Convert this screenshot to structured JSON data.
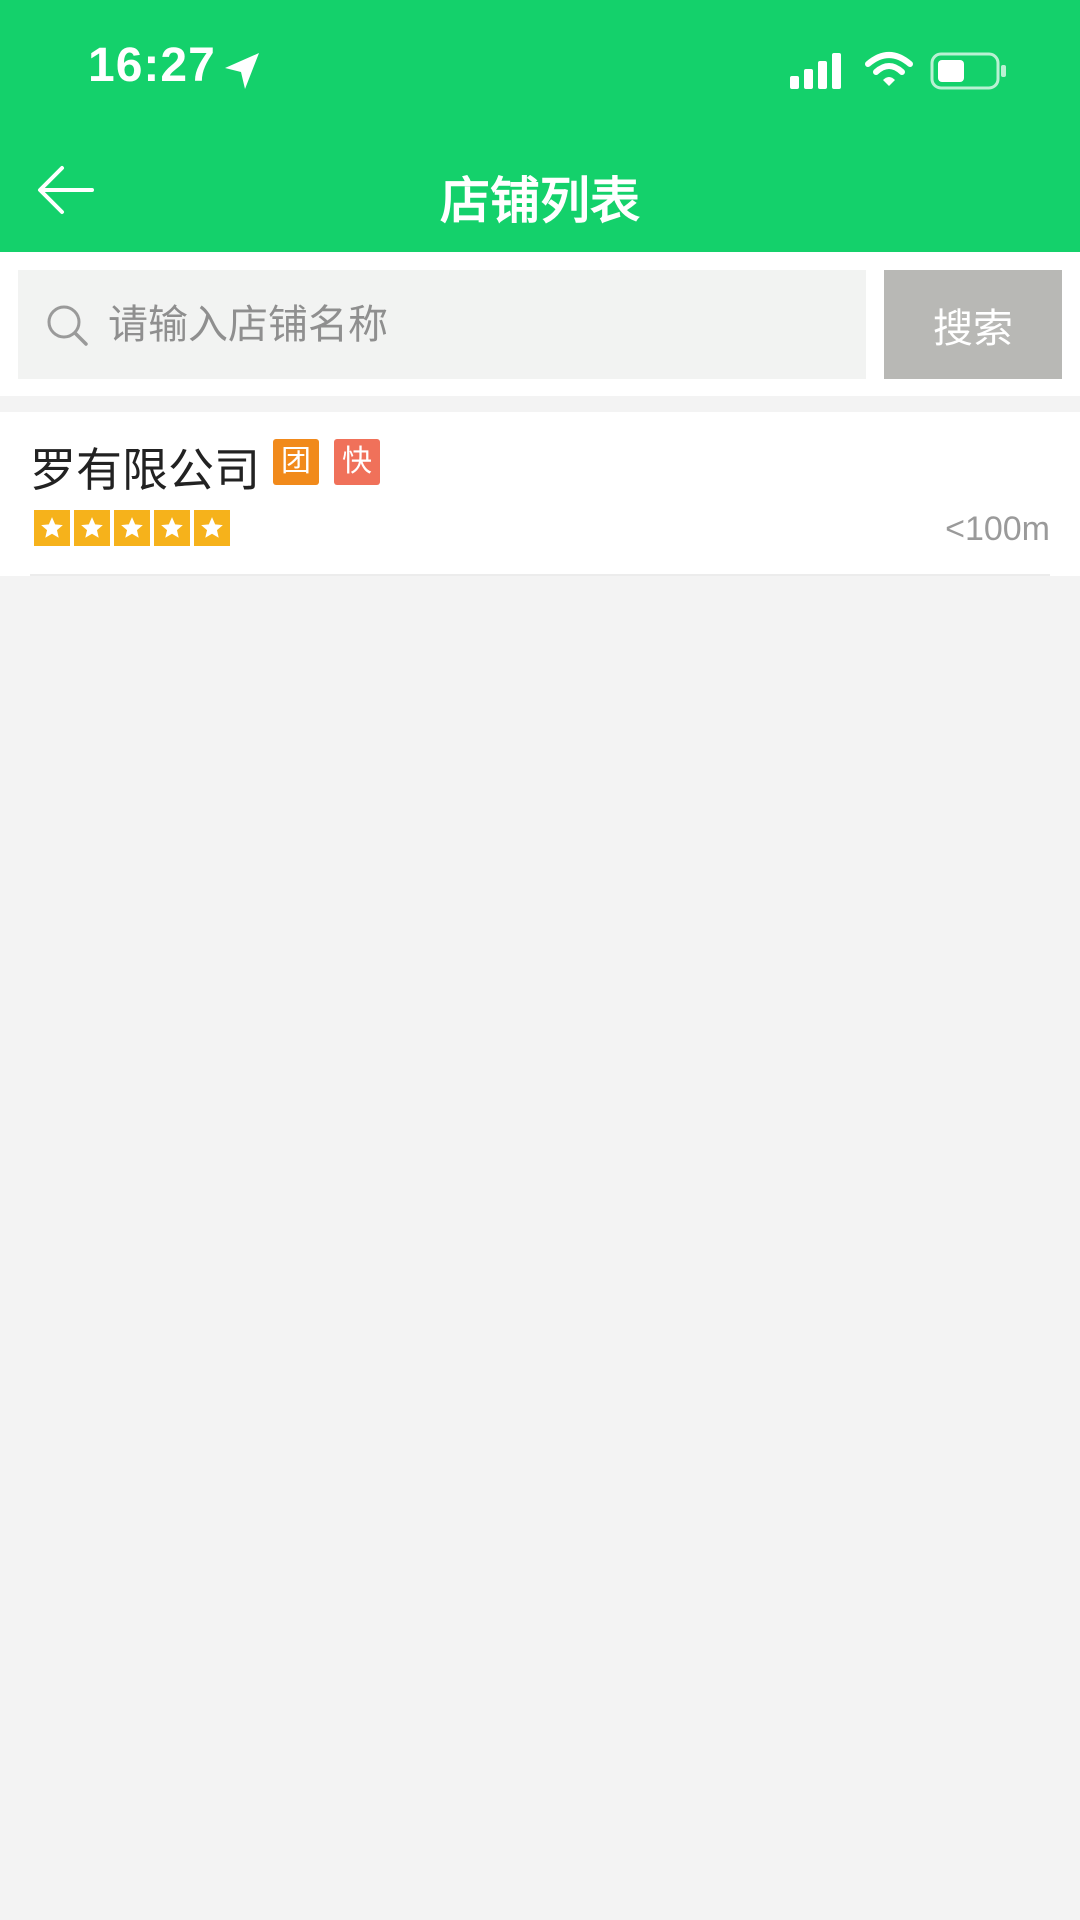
{
  "status_bar": {
    "time": "16:27",
    "icons": [
      "location-arrow-icon",
      "signal-icon",
      "wifi-icon",
      "battery-icon"
    ]
  },
  "nav": {
    "title": "店铺列表",
    "back_icon": "back-arrow-icon"
  },
  "search": {
    "placeholder": "请输入店铺名称",
    "value": "",
    "button_label": "搜索",
    "icon": "search-icon"
  },
  "stores": [
    {
      "name": "罗有限公司",
      "tags": [
        "团",
        "快"
      ],
      "rating": 5,
      "rating_max": 5,
      "distance": "<100m"
    }
  ],
  "colors": {
    "primary": "#14d16b",
    "tag_group": "#f18a1b",
    "tag_fast": "#f0715a",
    "star": "#f6b21b",
    "search_button": "#b8b8b5",
    "background": "#f3f3f3"
  }
}
